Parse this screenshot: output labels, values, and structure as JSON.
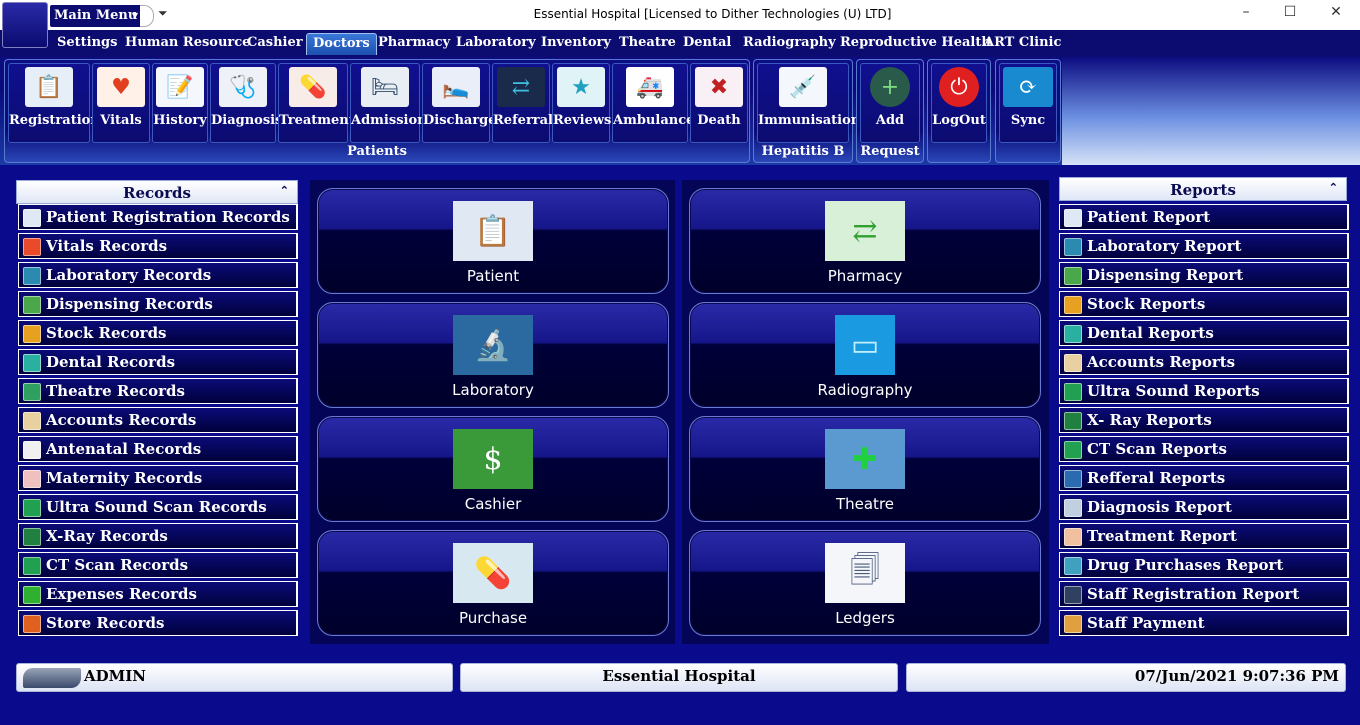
{
  "window": {
    "title": "Essential Hospital [Licensed to Dither Technologies (U) LTD]",
    "main_menu_label": "Main Menu",
    "controls": {
      "minimize": "–",
      "maximize": "☐",
      "close": "✕"
    }
  },
  "tabs": [
    {
      "label": "Settings"
    },
    {
      "label": "Human Resource"
    },
    {
      "label": "Cashier"
    },
    {
      "label": "Doctors",
      "active": true
    },
    {
      "label": "Pharmacy"
    },
    {
      "label": "Laboratory"
    },
    {
      "label": "Inventory"
    },
    {
      "label": "Theatre"
    },
    {
      "label": "Dental"
    },
    {
      "label": "Radiography"
    },
    {
      "label": "Reproductive Health"
    },
    {
      "label": "ART Clinic"
    }
  ],
  "ribbon": {
    "groups": {
      "patients": "Patients",
      "hepatitis": "Hepatitis B",
      "request": "Request"
    },
    "buttons": {
      "registration": "Registration",
      "vitals": "Vitals",
      "history": "History",
      "diagnosis": "Diagnosis",
      "treatment": "Treatment",
      "admission": "Admission",
      "discharge": "Discharge",
      "referral": "Referral",
      "reviews": "Reviews",
      "ambulance": "Ambulance",
      "death": "Death",
      "immunisation": "Immunisation",
      "add": "Add",
      "logout": "LogOut",
      "sync": "Sync"
    }
  },
  "records": {
    "title": "Records",
    "items": [
      {
        "label": "Patient Registration Records",
        "icon": "clipboard-icon",
        "color": "#dfe8f5"
      },
      {
        "label": "Vitals Records",
        "icon": "heartbeat-icon",
        "color": "#e84a2a"
      },
      {
        "label": "Laboratory Records",
        "icon": "microscope-icon",
        "color": "#2a8ab0"
      },
      {
        "label": "Dispensing Records",
        "icon": "pills-icon",
        "color": "#4aa84a"
      },
      {
        "label": "Stock Records",
        "icon": "boxes-icon",
        "color": "#e8a020"
      },
      {
        "label": "Dental Records",
        "icon": "tooth-icon",
        "color": "#2ab0a0"
      },
      {
        "label": "Theatre Records",
        "icon": "theatre-icon",
        "color": "#30a060"
      },
      {
        "label": "Accounts Records",
        "icon": "ledger-icon",
        "color": "#e8d0a0"
      },
      {
        "label": "Antenatal Records",
        "icon": "antenatal-icon",
        "color": "#f0f0f0"
      },
      {
        "label": "Maternity Records",
        "icon": "maternity-icon",
        "color": "#f0c0c0"
      },
      {
        "label": "Ultra Sound Scan Records",
        "icon": "ultrasound-icon",
        "color": "#20a050"
      },
      {
        "label": "X-Ray Records",
        "icon": "xray-icon",
        "color": "#208040"
      },
      {
        "label": "CT Scan Records",
        "icon": "ctscan-icon",
        "color": "#20a050"
      },
      {
        "label": "Expenses Records",
        "icon": "expenses-icon",
        "color": "#30b030"
      },
      {
        "label": "Store Records",
        "icon": "store-icon",
        "color": "#e06020"
      }
    ]
  },
  "reports": {
    "title": "Reports",
    "items": [
      {
        "label": "Patient Report",
        "icon": "clipboard-icon",
        "color": "#dfe8f5"
      },
      {
        "label": "Laboratory Report",
        "icon": "microscope-icon",
        "color": "#2a8ab0"
      },
      {
        "label": "Dispensing Report",
        "icon": "pills-icon",
        "color": "#4aa84a"
      },
      {
        "label": "Stock Reports",
        "icon": "boxes-icon",
        "color": "#e8a020"
      },
      {
        "label": "Dental Reports",
        "icon": "tooth-icon",
        "color": "#2ab0a0"
      },
      {
        "label": "Accounts Reports",
        "icon": "ledger-icon",
        "color": "#e8d0a0"
      },
      {
        "label": "Ultra Sound Reports",
        "icon": "ultrasound-icon",
        "color": "#20a050"
      },
      {
        "label": "X- Ray Reports",
        "icon": "xray-icon",
        "color": "#208040"
      },
      {
        "label": "CT Scan Reports",
        "icon": "ctscan-icon",
        "color": "#20a050"
      },
      {
        "label": "Refferal Reports",
        "icon": "referral-icon",
        "color": "#2a6ab0"
      },
      {
        "label": "Diagnosis Report",
        "icon": "diagnosis-icon",
        "color": "#c0d0e0"
      },
      {
        "label": "Treatment Report",
        "icon": "treatment-icon",
        "color": "#f0c0a0"
      },
      {
        "label": "Drug Purchases Report",
        "icon": "purchase-icon",
        "color": "#40a0c0"
      },
      {
        "label": "Staff Registration Report",
        "icon": "staff-icon",
        "color": "#304060"
      },
      {
        "label": "Staff Payment",
        "icon": "payment-icon",
        "color": "#e0a040"
      }
    ]
  },
  "tiles": {
    "patient": "Patient",
    "laboratory": "Laboratory",
    "cashier": "Cashier",
    "purchase": "Purchase",
    "pharmacy": "Pharmacy",
    "radiography": "Radiography",
    "theatre": "Theatre",
    "ledgers": "Ledgers"
  },
  "status": {
    "user": "ADMIN",
    "facility": "Essential Hospital",
    "datetime": "07/Jun/2021 9:07:36 PM"
  }
}
